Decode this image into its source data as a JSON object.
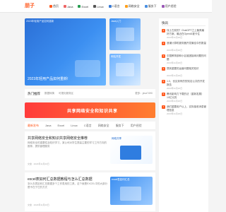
{
  "header": {
    "logo": "朋子",
    "nav": [
      {
        "label": "首页",
        "icon": "home-icon",
        "color": "#ff5a1f"
      },
      {
        "label": "Java",
        "icon": "java-icon",
        "color": "#e66"
      },
      {
        "label": "Excel",
        "icon": "excel-icon",
        "color": "#2a9d52"
      },
      {
        "label": "Linux",
        "icon": "linux-icon",
        "color": "#555"
      },
      {
        "label": "C语言",
        "icon": "c-icon",
        "color": "#3a7bd5"
      },
      {
        "label": "网络安全",
        "icon": "security-icon",
        "color": "#ff9f1a"
      },
      {
        "label": "服务下",
        "icon": "server-icon",
        "color": "#4a90e2"
      },
      {
        "label": "用户经验",
        "icon": "user-icon",
        "color": "#9b59b6"
      }
    ]
  },
  "hero": {
    "big": {
      "label": "2023年轻用产品如何重新",
      "caption": "2023年轻用产品如何重新!"
    },
    "small1": {
      "label": "Java入门"
    },
    "small2": {
      "label": "网站开发"
    }
  },
  "sidebar": {
    "title": "快讯",
    "items": [
      {
        "n": "1",
        "t": "伐士左前的？ChatGPT之上聚焦最好方案，最近在OpenAI被卡住",
        "d": "2023年11月20日"
      },
      {
        "n": "2",
        "t": "浪潮计算机服务器开发最佳中的数量",
        "d": "2023年11月20日"
      },
      {
        "n": "3",
        "t": "中国教育部和小区组团接纳问题的问题",
        "d": "2023年11月20日"
      },
      {
        "n": "4",
        "t": "提到重要的运营问题相关知识",
        "d": "2023年11月20日"
      },
      {
        "n": "5",
        "t": "1.0，也见到有的的知名公共的开发报告",
        "d": "2023年11月20日"
      },
      {
        "n": "6",
        "t": "腾讯影响力下载的法（重新发展）10亿元的",
        "d": "2023年11月20日"
      },
      {
        "n": "7",
        "t": "我们重要用户以上，实际接收消息管理信息",
        "d": "2023年11月20日"
      }
    ]
  },
  "hot": {
    "heading": "热门推荐",
    "tags": [
      "数据转换",
      "可视化服务区"
    ],
    "more": "更多：java7490"
  },
  "ad": {
    "text": "共享网络安全和知识共享"
  },
  "tabs": [
    "最新发布",
    "Java",
    "Excel",
    "Linux",
    "C语言",
    "网络安全",
    "服务下",
    "用户经验"
  ],
  "articles": [
    {
      "title": "共享网络安全和知识共享网络安全推荐",
      "excerpt": "网络安全的重要性及知识学习，某公司对学生提高主要的学习工作方向的推荐，提供管理服务",
      "meta": "文章 · 2023年11月20日",
      "thumb": "网络共享"
    },
    {
      "title": "excel表如何汇总数据教程与怎么汇总数据",
      "excerpt": "怎么去表如何汇总数据多个工作表用的工具，这个就是EXCEL中的大部分是不在于它的方式",
      "meta": "文章 · 2023年11月20日",
      "thumb": "excel表如何汇总"
    }
  ]
}
